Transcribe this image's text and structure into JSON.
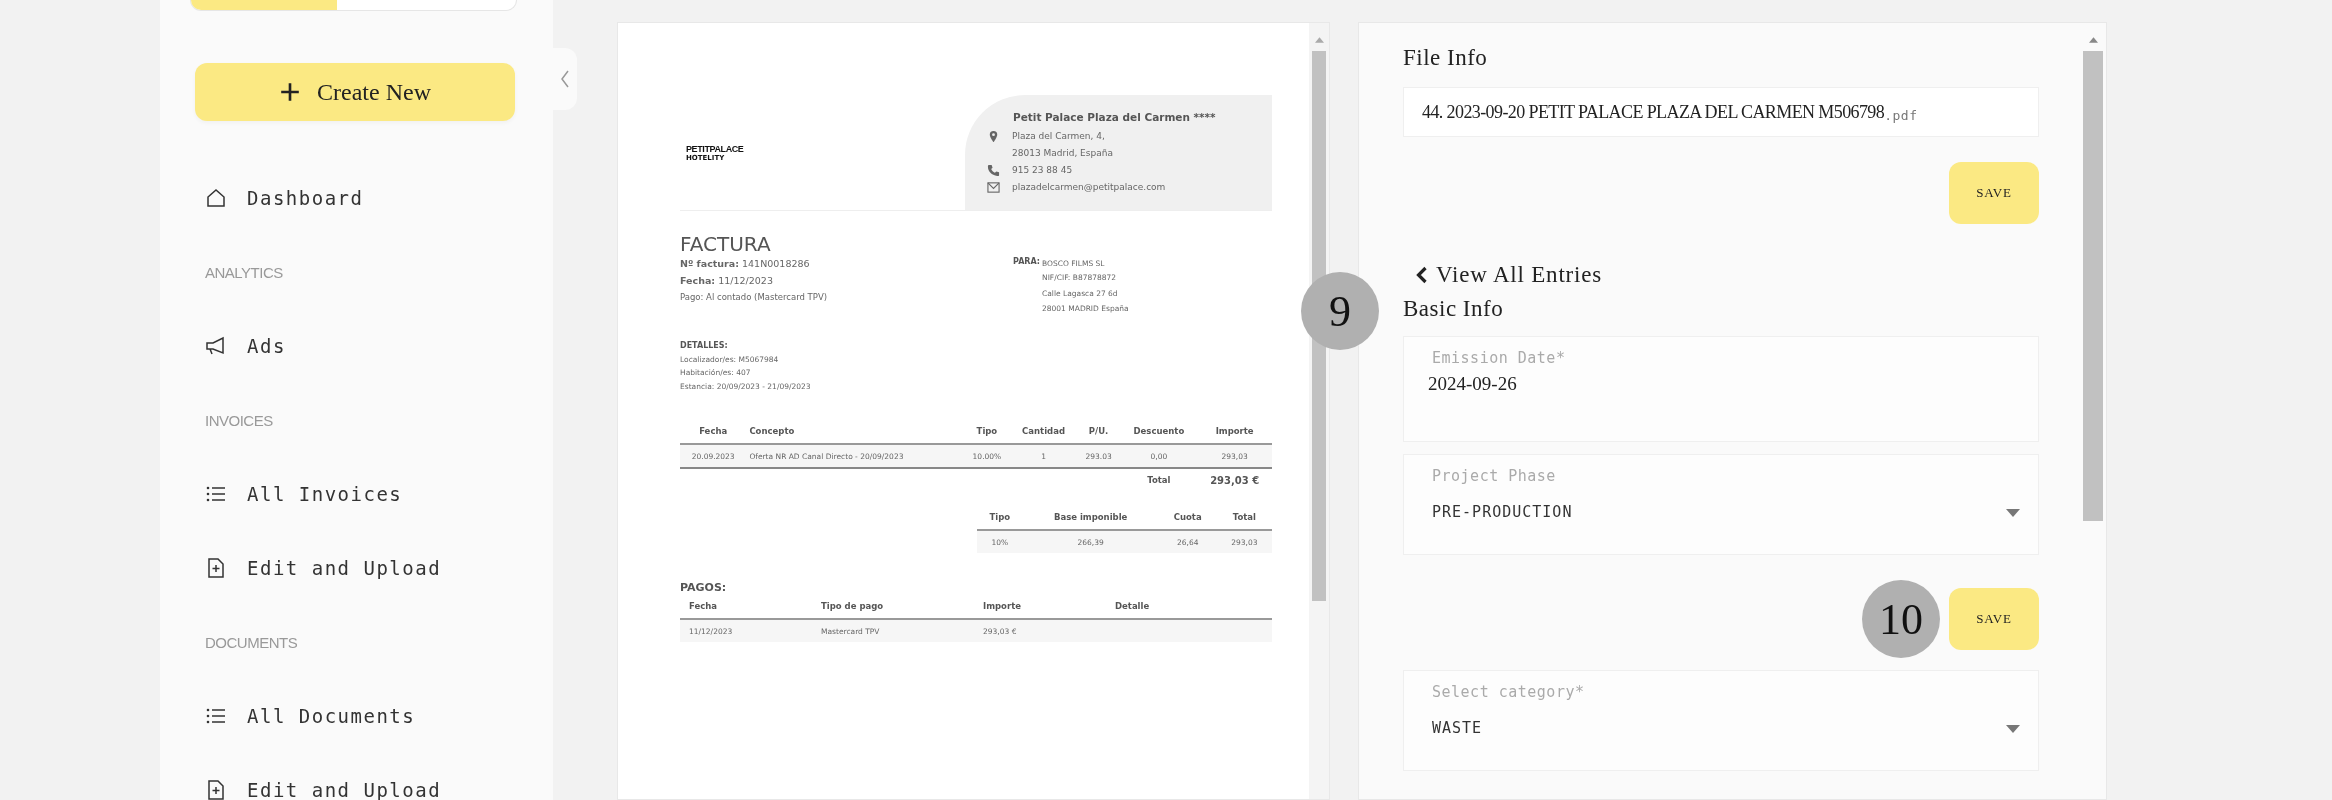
{
  "sidebar": {
    "create_button": "Create New",
    "items": [
      {
        "kind": "dashboard",
        "label": "Dashboard"
      },
      {
        "kind": "section",
        "label": "ANALYTICS"
      },
      {
        "kind": "ads",
        "label": "Ads"
      },
      {
        "kind": "section",
        "label": "INVOICES"
      },
      {
        "kind": "list",
        "label": "All Invoices"
      },
      {
        "kind": "upload",
        "label": "Edit and Upload"
      },
      {
        "kind": "section",
        "label": "DOCUMENTS"
      },
      {
        "kind": "list",
        "label": "All Documents"
      },
      {
        "kind": "upload",
        "label": "Edit and Upload"
      }
    ]
  },
  "document": {
    "logo": {
      "name": "PETITPALACE",
      "sub": "HOTELITY"
    },
    "hotel": {
      "name": "Petit Palace Plaza del Carmen ****",
      "address": [
        "Plaza del Carmen, 4,",
        "28013 Madrid, España"
      ],
      "phone": "915 23 88 45",
      "email": "plazadelcarmen@petitpalace.com"
    },
    "title": "FACTURA",
    "meta": [
      "**Nº factura:** 141N0018286",
      "**Fecha:** 11/12/2023",
      "Pago: Al contado (Mastercard TPV)"
    ],
    "recipient": {
      "label": "PARA:",
      "lines": [
        "BOSCO FILMS SL",
        "NIF/CIF: B87878872",
        "Calle Lagasca 27 6d",
        "28001 MADRID España"
      ]
    },
    "details": {
      "heading": "DETALLES:",
      "lines": [
        "Localizador/es: M5067984",
        "Habitación/es: 407",
        "Estancia: 20/09/2023 - 21/09/2023"
      ]
    },
    "lines_table": {
      "columns": [
        "Fecha",
        "Concepto",
        "Tipo",
        "Cantidad",
        "P/U.",
        "Descuento",
        "Importe"
      ],
      "rows": [
        [
          "20.09.2023",
          "Oferta NR AD Canal Directo - 20/09/2023",
          "10.00%",
          "1",
          "293.03",
          "0,00",
          "293,03"
        ]
      ],
      "total_label": "Total",
      "total_value": "293,03 €"
    },
    "tax_table": {
      "columns": [
        "Tipo",
        "Base imponible",
        "Cuota",
        "Total"
      ],
      "rows": [
        [
          "10%",
          "266,39",
          "26,64",
          "293,03"
        ]
      ]
    },
    "payments": {
      "heading": "PAGOS:",
      "columns": [
        "Fecha",
        "Tipo de pago",
        "Importe",
        "Detalle"
      ],
      "rows": [
        [
          "11/12/2023",
          "Mastercard TPV",
          "293,03 €"
        ]
      ]
    }
  },
  "file_info": {
    "title": "File Info",
    "filename": "44. 2023-09-20 PETIT PALACE PLAZA DEL CARMEN M506798",
    "extension": ".pdf",
    "save": "SAVE"
  },
  "back_link": "View All Entries",
  "basic_info": {
    "title": "Basic Info",
    "marker": "9",
    "fields": [
      {
        "kind": "input",
        "label": "Emission Date*",
        "value": "2024-09-26"
      },
      {
        "kind": "select",
        "label": "Project Phase",
        "value": "PRE-PRODUCTION"
      },
      {
        "kind": "button",
        "label": "SAVE",
        "marker": "10"
      },
      {
        "kind": "select",
        "label": "Select category*",
        "value": "WASTE"
      }
    ]
  }
}
